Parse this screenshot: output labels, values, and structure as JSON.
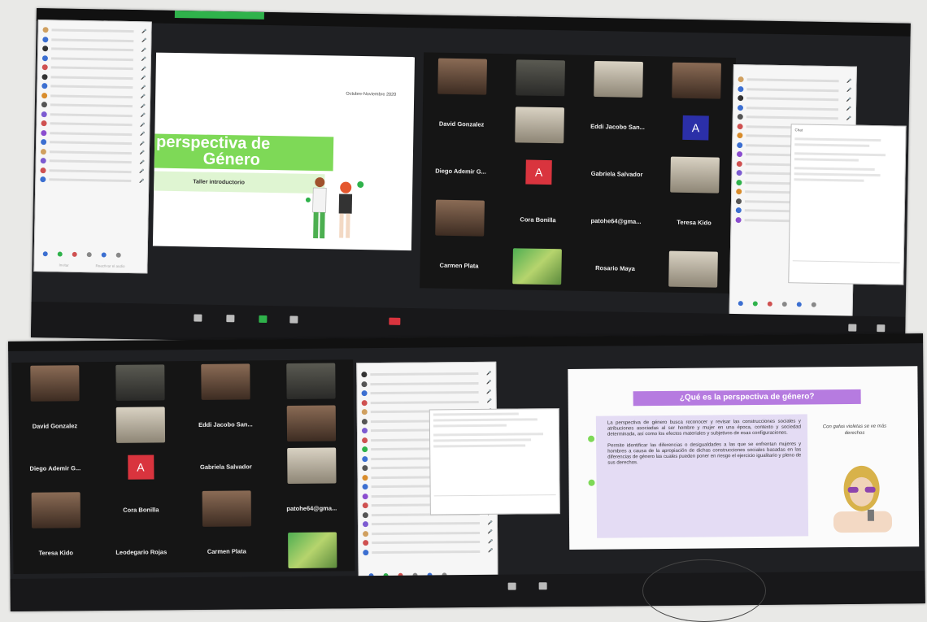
{
  "shot1": {
    "participants_panel": {
      "rows": [
        "Participante 1",
        "Participante 2",
        "Participante 3",
        "Participante 4",
        "Participante 5",
        "Participante 6",
        "Participante 7",
        "Participante 8",
        "Participante 9",
        "Participante 10",
        "Participante 11",
        "Participante 12",
        "Participante 13",
        "Participante 14",
        "Participante 15",
        "Participante 16",
        "Participante 17"
      ],
      "footer_left": "Invitar",
      "footer_right": "Reactivar el audio",
      "dot_colors": [
        "#d0a060",
        "#3c6fd1",
        "#333333",
        "#3c6fd1",
        "#cf5151",
        "#333333",
        "#3c6fd1",
        "#d98c2b",
        "#555555",
        "#7c5bd1",
        "#cf5151",
        "#8b4dcf",
        "#3c6fd1",
        "#d0a060",
        "#7c5bd1",
        "#cf5151",
        "#3c6fd1"
      ]
    },
    "slide": {
      "date": "Octubre-Noviembre 2020",
      "title_line1": "perspectiva de",
      "title_line2": "Género",
      "subtitle": "Taller introductorio"
    },
    "gallery": {
      "tiles": [
        {
          "kind": "video",
          "label": "",
          "style": "face"
        },
        {
          "kind": "video",
          "label": "",
          "style": "dark"
        },
        {
          "kind": "video",
          "label": "",
          "style": "room"
        },
        {
          "kind": "video",
          "label": "",
          "style": "face"
        },
        {
          "kind": "name",
          "label": "David Gonzalez"
        },
        {
          "kind": "video",
          "label": "",
          "style": "room"
        },
        {
          "kind": "name",
          "label": "Eddi Jacobo San..."
        },
        {
          "kind": "avatar",
          "label": "A",
          "color": "blue"
        },
        {
          "kind": "name",
          "label": "Diego Ademir G..."
        },
        {
          "kind": "avatar",
          "label": "A",
          "color": "red"
        },
        {
          "kind": "name",
          "label": "Gabriela Salvador"
        },
        {
          "kind": "video",
          "label": "",
          "style": "room"
        },
        {
          "kind": "video",
          "label": "",
          "style": "face"
        },
        {
          "kind": "name",
          "label": "Cora Bonilla"
        },
        {
          "kind": "name",
          "label": "patohe64@gma..."
        },
        {
          "kind": "name",
          "label": "Teresa Kido"
        },
        {
          "kind": "name",
          "label": "Carmen Plata"
        },
        {
          "kind": "video",
          "label": "",
          "style": "green"
        },
        {
          "kind": "name",
          "label": "Rosario Maya"
        },
        {
          "kind": "video",
          "label": "",
          "style": "room"
        }
      ]
    },
    "right_panel": {
      "footer_left": "Invitar",
      "footer_right": "Reactivar el audio",
      "dot_colors": [
        "#d0a060",
        "#3c6fd1",
        "#333333",
        "#3c6fd1",
        "#555555",
        "#cf5151",
        "#d98c2b",
        "#3c6fd1",
        "#8b4dcf",
        "#cf5151",
        "#7c5bd1",
        "#2fb24b",
        "#d98c2b",
        "#555555",
        "#3c6fd1",
        "#8b4dcf"
      ]
    },
    "chat": {
      "title": "Chat"
    }
  },
  "shot2": {
    "gallery": {
      "tiles": [
        {
          "kind": "video",
          "label": "",
          "style": "face"
        },
        {
          "kind": "video",
          "label": "",
          "style": "dark"
        },
        {
          "kind": "video",
          "label": "",
          "style": "face"
        },
        {
          "kind": "video",
          "label": "",
          "style": "dark"
        },
        {
          "kind": "name",
          "label": "David Gonzalez"
        },
        {
          "kind": "video",
          "label": "",
          "style": "room"
        },
        {
          "kind": "name",
          "label": "Eddi Jacobo San..."
        },
        {
          "kind": "video",
          "label": "",
          "style": "face"
        },
        {
          "kind": "name",
          "label": "Diego Ademir G..."
        },
        {
          "kind": "avatar",
          "label": "A",
          "color": "red"
        },
        {
          "kind": "name",
          "label": "Gabriela Salvador"
        },
        {
          "kind": "video",
          "label": "",
          "style": "room"
        },
        {
          "kind": "video",
          "label": "",
          "style": "face"
        },
        {
          "kind": "name",
          "label": "Cora Bonilla"
        },
        {
          "kind": "video",
          "label": "",
          "style": "face"
        },
        {
          "kind": "name",
          "label": "patohe64@gma..."
        },
        {
          "kind": "name",
          "label": "Teresa Kido"
        },
        {
          "kind": "name",
          "label": "Leodegario Rojas"
        },
        {
          "kind": "name",
          "label": "Carmen Plata"
        },
        {
          "kind": "video",
          "label": "",
          "style": "green"
        }
      ]
    },
    "participants_panel": {
      "footer_left": "Invitar",
      "footer_right": "Reactivar el audio",
      "dot_colors": [
        "#333333",
        "#555555",
        "#3c6fd1",
        "#cf5151",
        "#d0a060",
        "#555555",
        "#7c5bd1",
        "#cf5151",
        "#2fb24b",
        "#3c6fd1",
        "#555555",
        "#d98c2b",
        "#3c6fd1",
        "#8b4dcf",
        "#cf5151",
        "#555555",
        "#7c5bd1",
        "#d0a060",
        "#cf5151",
        "#3c6fd1"
      ]
    },
    "slide": {
      "heading": "¿Qué es la perspectiva de género?",
      "para1": "La perspectiva de género busca reconocer y revisar las construcciones sociales y atribuciones asociadas al ser hombre y mujer en una época, contexto y sociedad determinada, así como los efectos materiales y subjetivos de esas configuraciones.",
      "para2": "Permite identificar las diferencias o desigualdades a las que se enfrentan mujeres y hombres a causa de la apropiación de dichas construcciones sociales basadas en las diferencias de género las cuales pueden poner en riesgo el ejercicio igualitario y pleno de sus derechos.",
      "bubble": "Con gafas violetas se ve más derechos",
      "accent": "#a855d6"
    }
  }
}
